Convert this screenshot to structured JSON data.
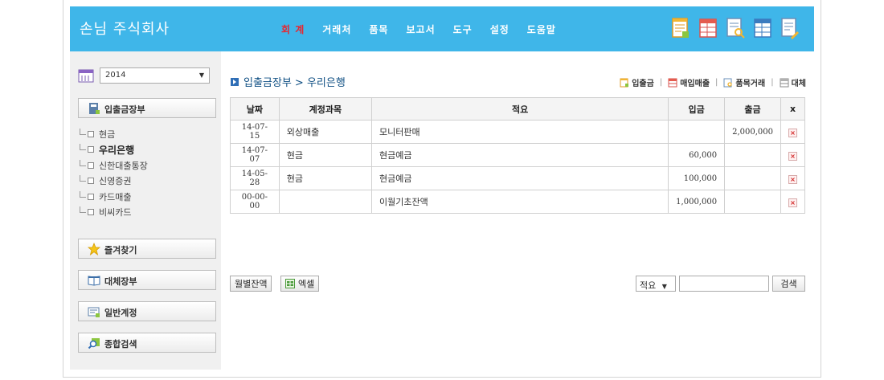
{
  "header": {
    "company": "손님 주식회사",
    "nav": [
      "회 계",
      "거래처",
      "품목",
      "보고서",
      "도구",
      "설정",
      "도움말"
    ],
    "active_nav": 0,
    "colors": {
      "bar": "#3fb6e9",
      "active": "#e8262f"
    }
  },
  "sidebar": {
    "year": "2014",
    "sections": {
      "cashbook": "입출금장부",
      "favorites": "즐겨찾기",
      "transfer_book": "대체장부",
      "general_account": "일반계정",
      "search_all": "종합검색"
    },
    "accounts": [
      "현금",
      "우리은행",
      "신한대출통장",
      "신영증권",
      "카드매출",
      "비씨카드"
    ],
    "selected_account": 1
  },
  "main": {
    "breadcrumb": "입출금장부 > 우리은행",
    "quick_links": [
      "입출금",
      "매입매출",
      "품목거래",
      "대체"
    ],
    "table": {
      "headers": [
        "날짜",
        "계정과목",
        "적요",
        "입금",
        "출금",
        "x"
      ],
      "rows": [
        {
          "date": "14-07-15",
          "account": "외상매출",
          "memo": "모니터판매",
          "in": "",
          "out": "2,000,000"
        },
        {
          "date": "14-07-07",
          "account": "현금",
          "memo": "현금예금",
          "in": "60,000",
          "out": ""
        },
        {
          "date": "14-05-28",
          "account": "현금",
          "memo": "현금예금",
          "in": "100,000",
          "out": ""
        },
        {
          "date": "00-00-00",
          "account": "",
          "memo": "이월기초잔액",
          "in": "1,000,000",
          "out": ""
        }
      ]
    },
    "buttons": {
      "monthly_balance": "월별잔액",
      "excel": "엑셀",
      "search": "검색"
    },
    "search": {
      "field": "적요",
      "value": ""
    }
  }
}
